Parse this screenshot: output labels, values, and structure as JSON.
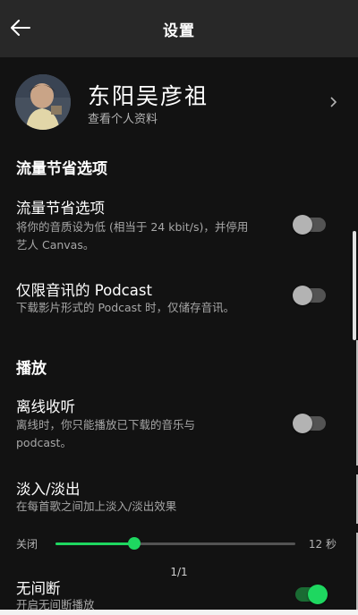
{
  "header": {
    "title": "设置"
  },
  "profile": {
    "name": "东阳吴彦祖",
    "subtitle": "查看个人资料"
  },
  "sections": {
    "data_saver": {
      "title": "流量节省选项",
      "row": {
        "title": "流量节省选项",
        "desc_line1": "将你的音质设为低 (相当于 24 kbit/s)，并停用",
        "desc_line2": "艺人 Canvas。",
        "enabled": false
      }
    },
    "podcast_audio_only": {
      "title": "仅限音讯的 Podcast",
      "desc": "下载影片形式的 Podcast 时，仅储存音讯。",
      "enabled": false
    },
    "playback": {
      "title": "播放",
      "offline": {
        "title": "离线收听",
        "desc_line1": "离线时，你只能播放已下载的音乐与",
        "desc_line2": "podcast。",
        "enabled": false
      },
      "crossfade": {
        "title": "淡入/淡出",
        "desc": "在每首歌之间加上淡入/淡出效果",
        "min_label": "关闭",
        "max_label": "12 秒",
        "value": 0.33
      },
      "gapless": {
        "title": "无间断",
        "desc": "开启无间断播放",
        "enabled": true
      }
    }
  },
  "page_indicator": "1/1",
  "colors": {
    "accent": "#1ed760",
    "background": "#121212",
    "header": "#282828"
  }
}
